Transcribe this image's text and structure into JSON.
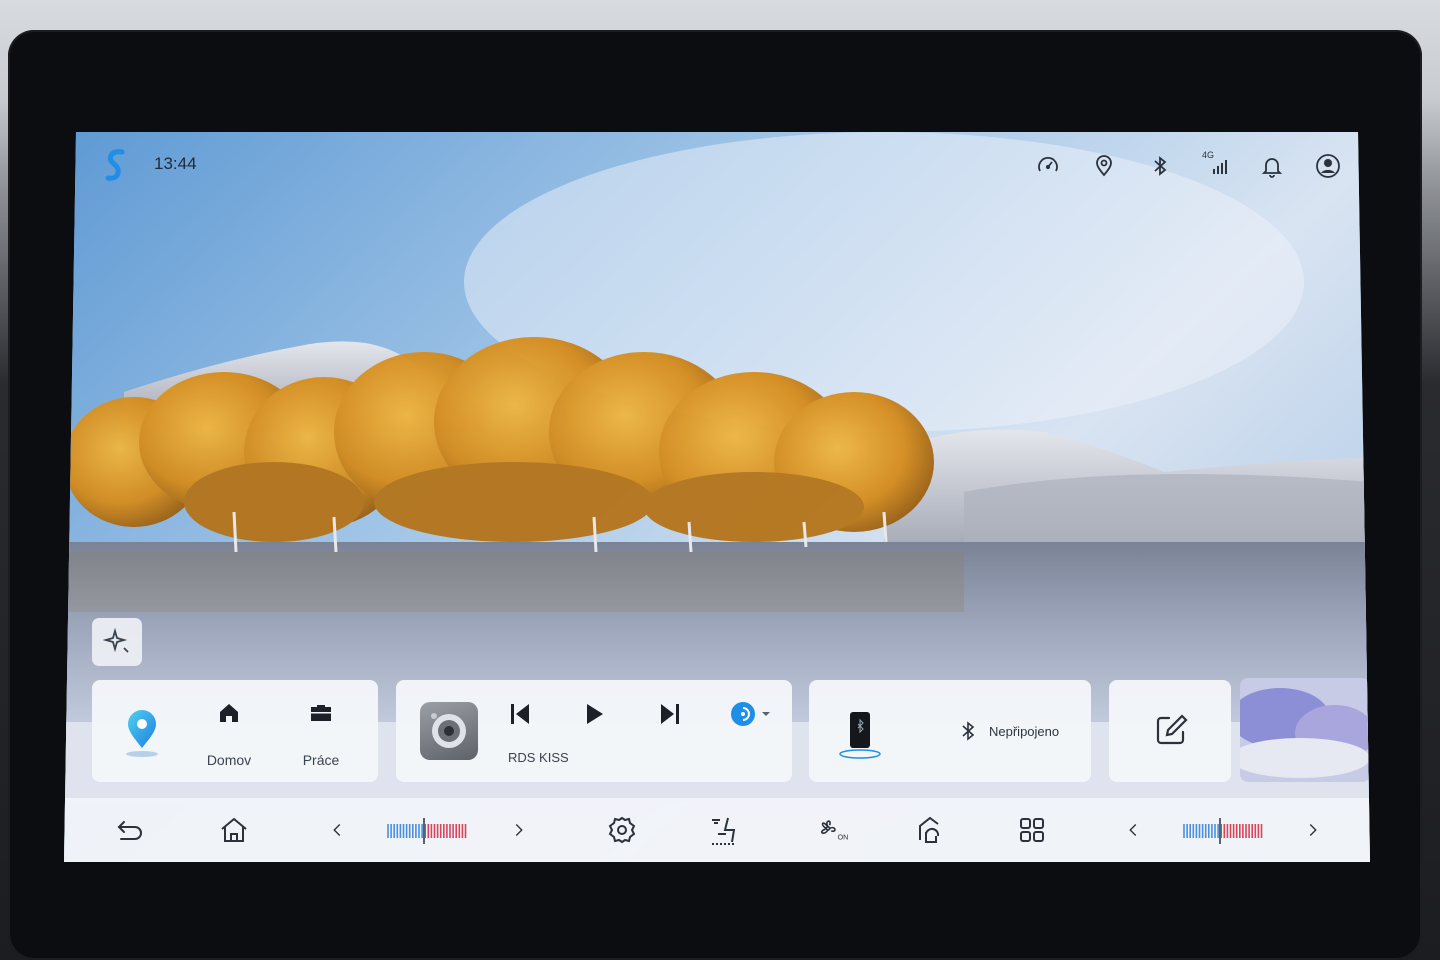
{
  "status_bar": {
    "time": "13:44",
    "network_label": "4G",
    "icons": [
      "logo-icon",
      "speedometer-icon",
      "location-icon",
      "bluetooth-icon",
      "signal-icon",
      "bell-icon",
      "profile-icon"
    ]
  },
  "navigation_card": {
    "icons": [
      "map-pin-icon",
      "home-icon",
      "briefcase-icon"
    ],
    "home_label": "Domov",
    "work_label": "Práce"
  },
  "media_card": {
    "station": "RDS KISS",
    "icons": [
      "radio-icon",
      "previous-icon",
      "play-icon",
      "next-icon",
      "source-icon"
    ]
  },
  "phone_card": {
    "bluetooth_status": "Nepřipojeno",
    "icons": [
      "phone-icon",
      "bluetooth-icon"
    ]
  },
  "edit_card": {
    "icons": [
      "edit-icon"
    ]
  },
  "dock": {
    "icons": [
      "back-icon",
      "home-icon",
      "chevron-left-icon",
      "temperature-slider-left",
      "chevron-right-icon",
      "settings-icon",
      "seat-climate-icon",
      "fan-icon",
      "recirculation-icon",
      "apps-grid-icon",
      "chevron-left-icon",
      "temperature-slider-right",
      "chevron-right-icon"
    ],
    "fan_state": "ON"
  },
  "colors": {
    "accent_blue": "#1e8ee6",
    "icon_dark": "#2b323c",
    "temp_cold": "#4a8fe0",
    "temp_hot": "#d8455a"
  }
}
